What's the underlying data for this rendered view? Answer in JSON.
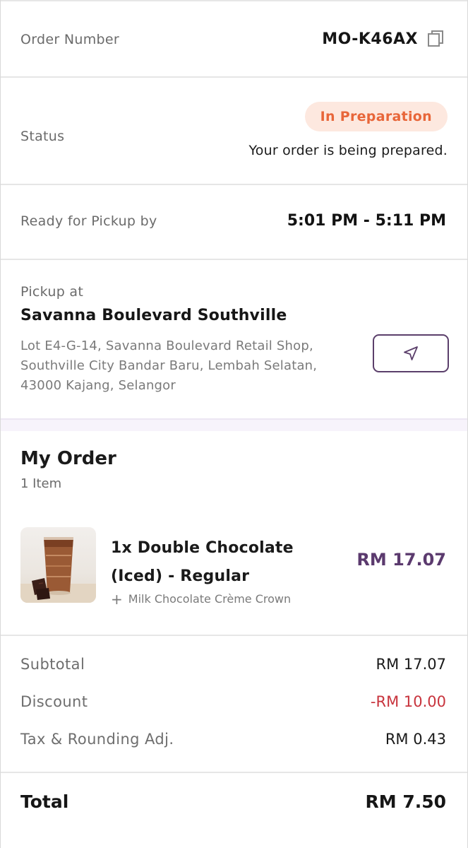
{
  "order": {
    "number_label": "Order Number",
    "number_value": "MO-K46AX"
  },
  "status": {
    "label": "Status",
    "badge": "In Preparation",
    "description": "Your order is being prepared."
  },
  "pickup_time": {
    "label": "Ready for Pickup by",
    "value": "5:01 PM - 5:11 PM"
  },
  "pickup_location": {
    "label": "Pickup at",
    "store_name": "Savanna Boulevard Southville",
    "address": "Lot E4-G-14, Savanna Boulevard Retail Shop, Southville City Bandar Baru, Lembah Selatan, 43000 Kajang, Selangor",
    "nav_icon": "navigation-arrow-icon"
  },
  "my_order": {
    "title": "My Order",
    "item_count": "1 Item",
    "items": [
      {
        "name": "1x Double Chocolate (Iced) - Regular",
        "addon": "Milk Chocolate Crème Crown",
        "price": "RM 17.07"
      }
    ]
  },
  "summary": {
    "subtotal_label": "Subtotal",
    "subtotal_value": "RM 17.07",
    "discount_label": "Discount",
    "discount_value": "-RM 10.00",
    "tax_label": "Tax & Rounding Adj.",
    "tax_value": "RM 0.43",
    "total_label": "Total",
    "total_value": "RM 7.50"
  },
  "colors": {
    "accent": "#5b3a6e",
    "status_text": "#e8663a",
    "status_bg": "#fde8df",
    "discount": "#c8343d"
  }
}
